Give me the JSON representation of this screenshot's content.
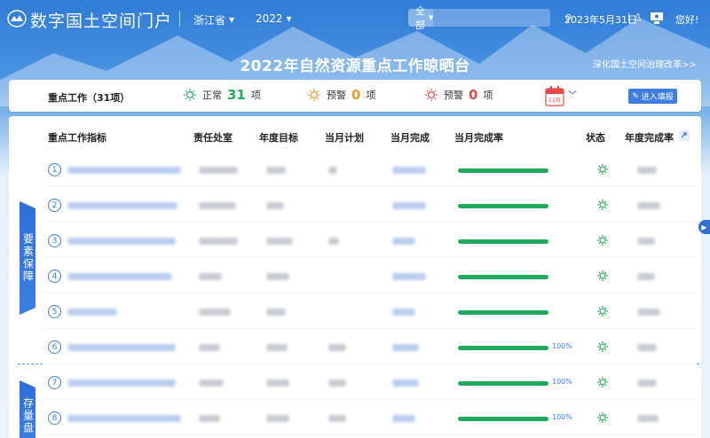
{
  "app": {
    "title": "数字国土空间门户"
  },
  "header": {
    "region": "浙江省",
    "year": "2022",
    "search_scope": "全部",
    "search_placeholder": "",
    "date": "2023年5月31日",
    "greeting": "您好!"
  },
  "page": {
    "title": "2022年自然资源重点工作晾晒台",
    "reform_link": "深化国土空间治理改革>>"
  },
  "summary": {
    "label": "重点工作（31项）",
    "normal_label": "正常",
    "normal_count": "31",
    "normal_unit": "项",
    "warn1_label": "预警",
    "warn1_count": "0",
    "warn1_unit": "项",
    "warn2_label": "预警",
    "warn2_count": "0",
    "warn2_unit": "项",
    "calendar_text": "12月",
    "enter_button": "进入填报"
  },
  "colors": {
    "normal": "#1eaa5a",
    "warn_orange": "#f19a2c",
    "warn_red": "#e84a4a",
    "accent": "#3d7ee0"
  },
  "table": {
    "columns": [
      "重点工作指标",
      "责任处室",
      "年度目标",
      "当月计划",
      "当月完成",
      "当月完成率",
      "状态",
      "年度完成率"
    ],
    "rows": [
      {
        "index": "1",
        "percent": ""
      },
      {
        "index": "2",
        "percent": ""
      },
      {
        "index": "3",
        "percent": ""
      },
      {
        "index": "4",
        "percent": ""
      },
      {
        "index": "5",
        "percent": ""
      },
      {
        "index": "6",
        "percent": "100%"
      },
      {
        "index": "7",
        "percent": "100%"
      },
      {
        "index": "8",
        "percent": "100%"
      }
    ],
    "groups": [
      {
        "label": "要素保障"
      },
      {
        "label": "存量盘"
      }
    ]
  }
}
